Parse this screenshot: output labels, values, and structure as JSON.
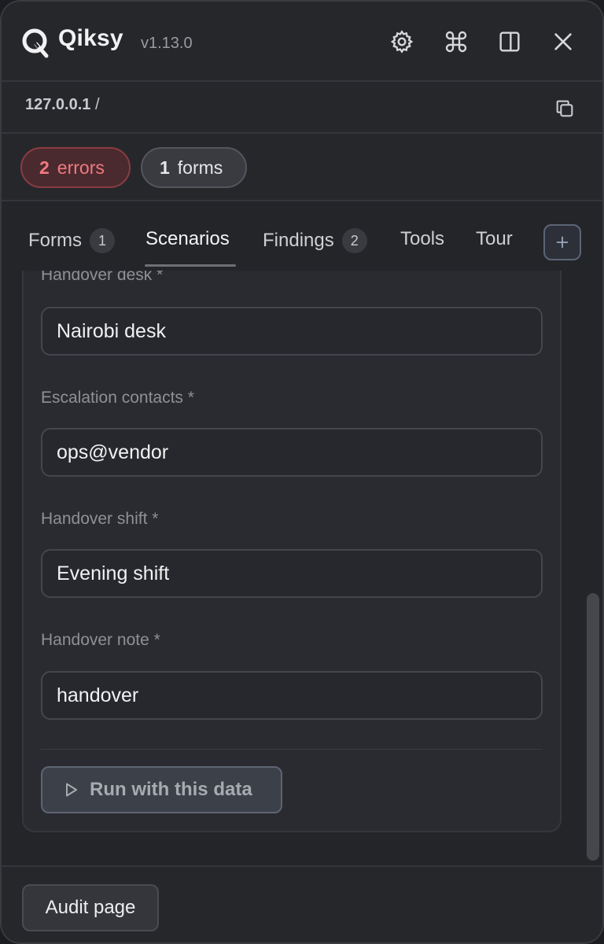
{
  "app": {
    "name": "Qiksy",
    "version": "v1.13.0"
  },
  "header_icons": [
    "settings-icon",
    "command-icon",
    "sidebar-toggle-icon",
    "close-icon"
  ],
  "url": {
    "host": "127.0.0.1",
    "path": "/"
  },
  "badges": {
    "errors": {
      "count": "2",
      "label": "errors"
    },
    "forms": {
      "count": "1",
      "label": "forms"
    }
  },
  "tabs": [
    {
      "label": "Forms",
      "count": "1"
    },
    {
      "label": "Scenarios"
    },
    {
      "label": "Findings",
      "count": "2"
    },
    {
      "label": "Tools"
    },
    {
      "label": "Tour"
    }
  ],
  "fields": [
    {
      "label": "Handover desk *",
      "value": "Nairobi desk"
    },
    {
      "label": "Escalation contacts *",
      "value": "ops@vendor"
    },
    {
      "label": "Handover shift *",
      "value": "Evening shift"
    },
    {
      "label": "Handover note *",
      "value": "handover"
    }
  ],
  "run_button": {
    "label": "Run with this data"
  },
  "footer": {
    "audit_label": "Audit page"
  },
  "colors": {
    "error": "#f07a80",
    "background": "#242529",
    "accent_border": "#5e6473"
  }
}
